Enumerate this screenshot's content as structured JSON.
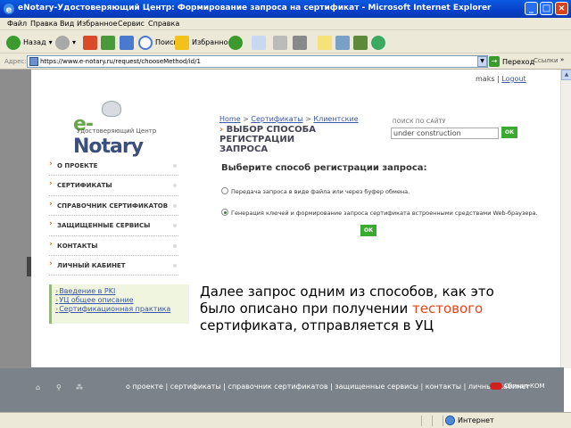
{
  "window": {
    "title": "eNotary-Удостоверяющий Центр: Формирование запроса на сертификат - Microsoft Internet Explorer",
    "buttons": {
      "minimize": "_",
      "maximize": "□",
      "close": "×"
    }
  },
  "menu": [
    "Файл",
    "Правка",
    "Вид",
    "Избранное",
    "Сервис",
    "Справка"
  ],
  "toolbar": {
    "back": "Назад",
    "search": "Поиск",
    "favorites": "Избранное"
  },
  "address": {
    "label": "Адрес:",
    "url": "https://www.e-notary.ru/request/chooseMethod/id/1",
    "go": "Переход",
    "links": "Ссылки"
  },
  "page": {
    "user": {
      "name": "maks",
      "sep": "|",
      "logout": "Logout"
    },
    "logo": {
      "name_e": "e-",
      "name_rest": "Notary",
      "subtitle": "Удостоверяющий Центр"
    },
    "breadcrumb": {
      "home": "Home",
      "sep": ">",
      "certs": "Сертификаты",
      "clients": "Клиентские"
    },
    "section_title": "ВЫБОР СПОСОБА РЕГИСТРАЦИИ ЗАПРОСА",
    "search": {
      "label": "ПОИСК ПО САЙТУ",
      "value": "under construction",
      "ok": "ОК"
    },
    "nav": [
      "О ПРОЕКТЕ",
      "СЕРТИФИКАТЫ",
      "СПРАВОЧНИК СЕРТИФИКАТОВ",
      "ЗАЩИЩЕННЫЕ СЕРВИСЫ",
      "КОНТАКТЫ",
      "ЛИЧНЫЙ КАБИНЕТ"
    ],
    "links": [
      "Введение в PKI",
      "УЦ общее описание",
      "Сертификационная практика"
    ],
    "question": "Выберите способ регистрации запроса:",
    "options": [
      "Передача запроса в виде файла или через буфер обмена.",
      "Генерация ключей и формирование запроса сертификата встроенными средствами Web-браузера."
    ],
    "selected_option": 1,
    "ok": "ОК",
    "footer": {
      "menu": "о проекте | сертификаты | справочник сертификатов | защищенные сервисы | контакты | личный кабинет",
      "brand": "Сигнал-КОМ"
    }
  },
  "overlay": {
    "line1": "Далее запрос одним из способов, как это",
    "line2": "было описано при  получении ",
    "highlight": "тестового",
    "line3": "сертификата, отправляется в УЦ"
  },
  "status": {
    "zone": "Интернет"
  },
  "colors": {
    "accent_green": "#3aaa30",
    "link_blue": "#3b57a5",
    "highlight": "#e2461e",
    "titlebar": "#0a5be0"
  }
}
